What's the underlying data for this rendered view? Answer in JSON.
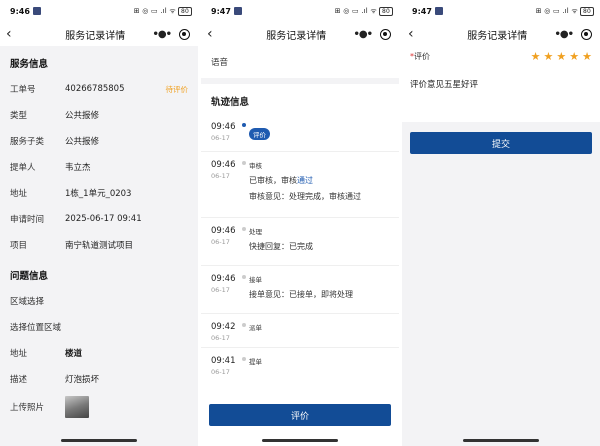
{
  "status_bar": {
    "screen1_time": "9:46",
    "screen2_time": "9:47",
    "screen3_time": "9:47",
    "battery": "80"
  },
  "nav": {
    "title": "服务记录详情"
  },
  "service_info": {
    "section_title": "服务信息",
    "fields": [
      {
        "label": "工单号",
        "value": "40266785805",
        "tag": "待评价"
      },
      {
        "label": "类型",
        "value": "公共报修"
      },
      {
        "label": "服务子类",
        "value": "公共报修"
      },
      {
        "label": "提单人",
        "value": "韦立杰"
      },
      {
        "label": "地址",
        "value": "1栋_1单元_0203"
      },
      {
        "label": "申请时间",
        "value": "2025-06-17 09:41"
      },
      {
        "label": "项目",
        "value": "南宁轨道测试项目"
      }
    ]
  },
  "problem_info": {
    "section_title": "问题信息",
    "fields": [
      {
        "label": "区域选择",
        "value": ""
      },
      {
        "label": "选择位置区域",
        "value": ""
      },
      {
        "label": "地址",
        "value": "楼道"
      },
      {
        "label": "描述",
        "value": "灯泡损坏"
      },
      {
        "label": "上传照片",
        "value": ""
      }
    ]
  },
  "track": {
    "voice_label": "语音",
    "section_title": "轨迹信息",
    "events": [
      {
        "time": "09:46",
        "date": "06-17",
        "type": "评价",
        "lines": []
      },
      {
        "time": "09:46",
        "date": "06-17",
        "type": "审核",
        "line1_prefix": "已审核，审核",
        "line1_link": "通过",
        "line2": "审核意见：处理完成，审核通过"
      },
      {
        "time": "09:46",
        "date": "06-17",
        "type": "处理",
        "line1": "快捷回复：已完成"
      },
      {
        "time": "09:46",
        "date": "06-17",
        "type": "接单",
        "line1": "接单意见：已接单，即将处理"
      },
      {
        "time": "09:42",
        "date": "06-17",
        "type": "派单"
      },
      {
        "time": "09:41",
        "date": "06-17",
        "type": "提单"
      }
    ],
    "evaluate_button": "评价"
  },
  "rating": {
    "label": "评价",
    "required_mark": "*",
    "stars": 5,
    "comment": "评价意见五星好评",
    "submit_button": "提交"
  },
  "colors": {
    "primary": "#124c96",
    "accent": "#f0a020",
    "link": "#1f5bb0"
  }
}
